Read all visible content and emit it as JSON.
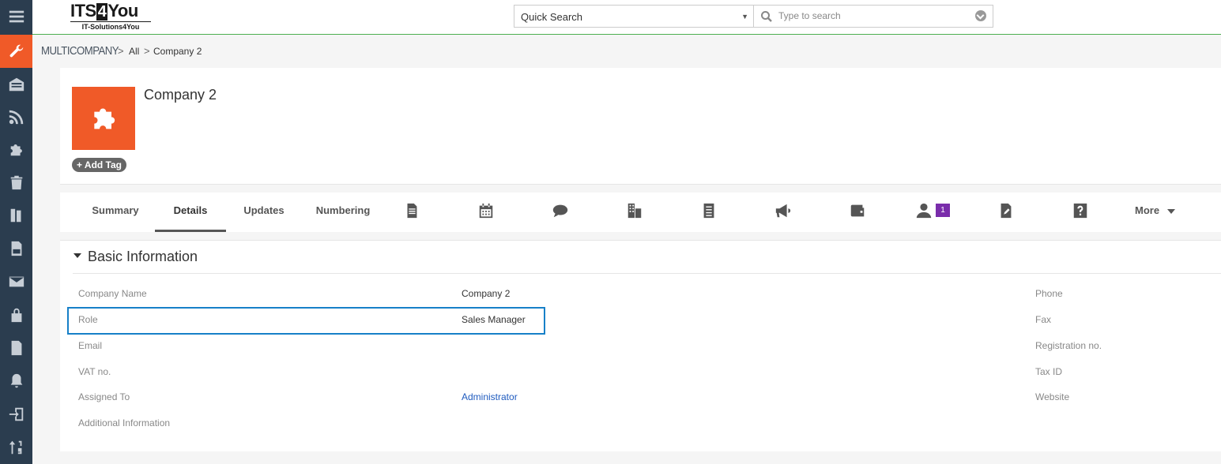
{
  "logo": {
    "main_a": "ITS",
    "main_b": "4",
    "main_c": "You",
    "sub": "IT-Solutions4You"
  },
  "search": {
    "scope": "Quick Search",
    "placeholder": "Type to search"
  },
  "breadcrumb": {
    "module": "MULTICOMPANY",
    "filter": "All",
    "record": "Company 2",
    "sep": ">"
  },
  "record": {
    "name": "Company 2",
    "add_tag": "+ Add Tag"
  },
  "tabs": {
    "items": [
      "Summary",
      "Details",
      "Updates",
      "Numbering"
    ],
    "active": "Details",
    "contacts_badge": "1",
    "more": "More"
  },
  "block": {
    "title": "Basic Information",
    "left_fields": [
      {
        "label": "Company Name",
        "value": "Company 2"
      },
      {
        "label": "Role",
        "value": "Sales Manager"
      },
      {
        "label": "Email",
        "value": ""
      },
      {
        "label": "VAT no.",
        "value": ""
      },
      {
        "label": "Assigned To",
        "value": "Administrator"
      },
      {
        "label": "Additional Information",
        "value": ""
      }
    ],
    "right_fields": [
      {
        "label": "Phone"
      },
      {
        "label": "Fax"
      },
      {
        "label": "Registration no."
      },
      {
        "label": "Tax ID"
      },
      {
        "label": "Website"
      }
    ]
  },
  "colors": {
    "accent": "#f05a28",
    "sidebar": "#2b3d4f",
    "highlight": "#1780c8",
    "badge": "#7a2dab",
    "link": "#1f5bbf"
  },
  "icons": {
    "sidebar": [
      "menu-icon",
      "wrench-icon",
      "email-inbox-icon",
      "rss-icon",
      "puzzle-icon",
      "trash-icon",
      "book-icon",
      "pdf-icon",
      "mail-icon",
      "lock-icon",
      "mail-template-icon",
      "bell-icon",
      "import-icon",
      "sort-numeric-icon"
    ],
    "tabs": [
      "document-icon",
      "calendar-icon",
      "comment-icon",
      "building-icon",
      "list-icon",
      "megaphone-icon",
      "wallet-icon",
      "user-icon",
      "edit-document-icon",
      "help-icon"
    ]
  }
}
